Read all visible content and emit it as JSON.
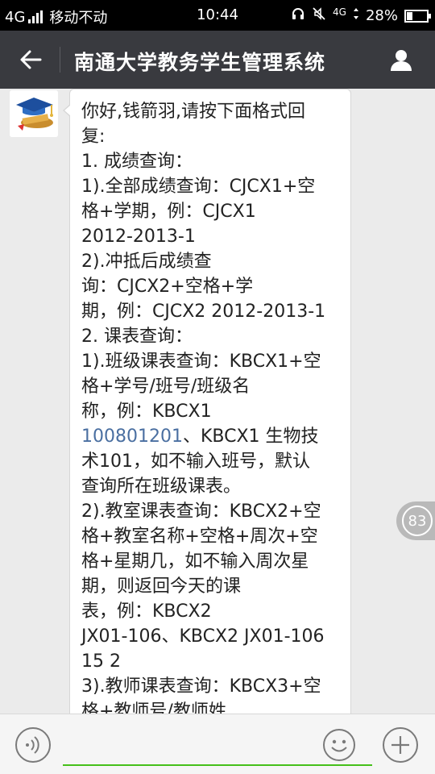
{
  "status_bar": {
    "network": "4G",
    "carrier": "移动不动",
    "time": "10:44",
    "network_small": "4G",
    "battery": "28%",
    "battery_level": 0.28
  },
  "title_bar": {
    "title": "南通大学教务学生管理系统",
    "back_icon": "back-arrow-icon",
    "profile_icon": "person-icon"
  },
  "message": {
    "lines": [
      {
        "text": "你好,钱箭羽,请按下面格式回"
      },
      {
        "text": "复:"
      },
      {
        "text": "1. 成绩查询："
      },
      {
        "text": "1).全部成绩查询：CJCX1+空"
      },
      {
        "text": "格+学期，例：CJCX1"
      },
      {
        "text": "2012-2013-1"
      },
      {
        "text": "2).冲抵后成绩查"
      },
      {
        "text": "询：CJCX2+空格+学"
      },
      {
        "text": "期，例：CJCX2 2012-2013-1"
      },
      {
        "text": "2. 课表查询："
      },
      {
        "text": "1).班级课表查询：KBCX1+空"
      },
      {
        "text": "格+学号/班号/班级名"
      },
      {
        "text": "称，例：KBCX1"
      },
      {
        "link": "100801201",
        "text": "、KBCX1 生物技"
      },
      {
        "text": "术101，如不输入班号，默认"
      },
      {
        "text": "查询所在班级课表。"
      },
      {
        "text": "2).教室课表查询：KBCX2+空"
      },
      {
        "text": "格+教室名称+空格+周次+空"
      },
      {
        "text": "格+星期几，如不输入周次星"
      },
      {
        "text": "期，则返回今天的课"
      },
      {
        "text": "表，例：KBCX2"
      },
      {
        "text": "JX01-106、KBCX2 JX01-106"
      },
      {
        "text": "15 2"
      },
      {
        "text": "3).教师课表查询：KBCX3+空"
      },
      {
        "text": "格+教师号/教师姓"
      }
    ]
  },
  "float_badge": "83",
  "input_bar": {
    "voice_icon": "voice-icon",
    "emoji_icon": "emoji-icon",
    "plus_icon": "plus-icon",
    "accent": "#45c01a"
  }
}
